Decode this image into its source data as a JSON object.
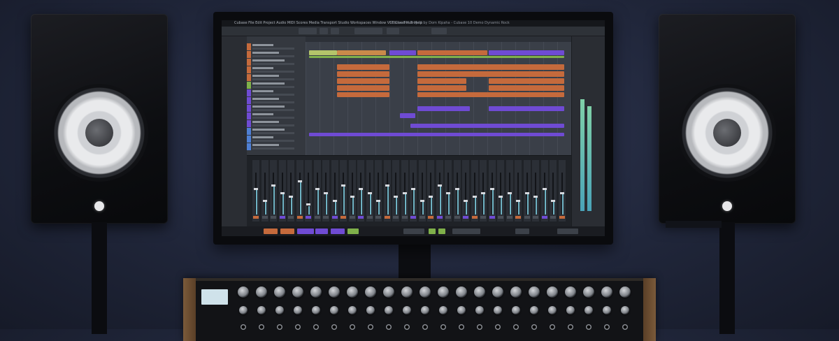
{
  "scene": "studio",
  "monitor": {
    "menu_items": [
      "Cubase",
      "File",
      "Edit",
      "Project",
      "Audio",
      "MIDI",
      "Scores",
      "Media",
      "Transport",
      "Studio",
      "Workspaces",
      "Window",
      "VST Cloud",
      "Hub",
      "Help"
    ],
    "window_title": "Cubase Pro Project by Dom Kipaha - Cubase 10 Demo Dynamic Rock"
  },
  "colors": {
    "clip_orange": "#c56a3c",
    "clip_purple": "#6f4bd3",
    "clip_green": "#7fb04a",
    "clip_blue": "#4e7fd4",
    "meter": "#6fb3c4"
  },
  "icons": [
    "speaker-logo-icon"
  ]
}
